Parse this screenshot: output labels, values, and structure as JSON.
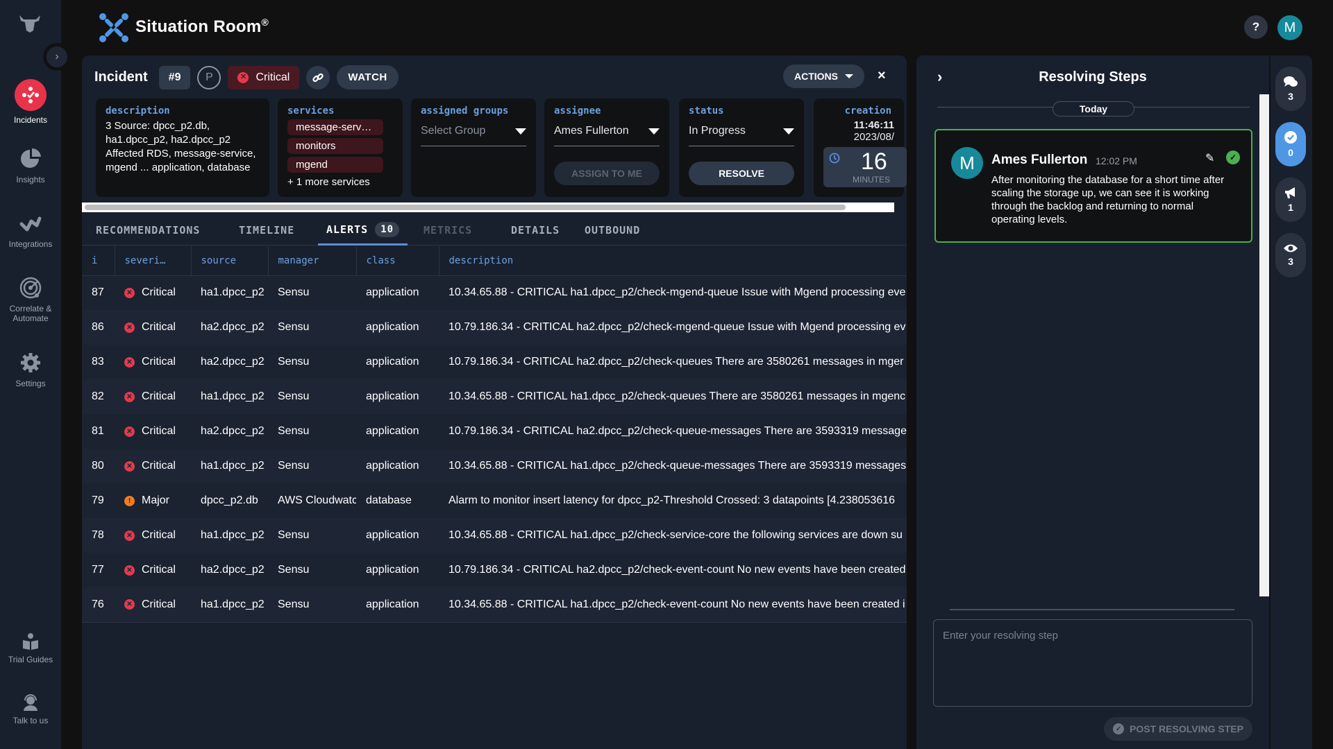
{
  "app": {
    "title": "Situation Room",
    "registered_mark": "®",
    "help_label": "?",
    "user_initial": "M"
  },
  "sidebar": {
    "expand_icon": "chevron-right-icon",
    "items": [
      {
        "label": "Incidents",
        "icon": "incidents-icon",
        "active": true
      },
      {
        "label": "Insights",
        "icon": "pie-chart-icon",
        "active": false
      },
      {
        "label": "Integrations",
        "icon": "integrations-icon",
        "active": false
      },
      {
        "label": "Correlate & Automate",
        "icon": "radar-icon",
        "active": false
      },
      {
        "label": "Settings",
        "icon": "gear-icon",
        "active": false
      }
    ],
    "bottom_items": [
      {
        "label": "Trial Guides",
        "icon": "book-reader-icon"
      },
      {
        "label": "Talk to us",
        "icon": "headset-icon"
      }
    ]
  },
  "incident": {
    "title": "Incident",
    "number": "#9",
    "priority": "P",
    "severity": "Critical",
    "watch_label": "WATCH",
    "actions_label": "ACTIONS",
    "close_label": "×",
    "description_label": "description",
    "description": "3 Source: dpcc_p2.db, ha1.dpcc_p2, ha2.dpcc_p2 Affected RDS, message-service, mgend ... application, database",
    "services_label": "services",
    "services": [
      "message-serv…",
      "monitors",
      "mgend"
    ],
    "services_more": "+ 1 more services",
    "assigned_groups_label": "assigned groups",
    "assigned_groups_placeholder": "Select Group",
    "assignee_label": "assignee",
    "assignee": "Ames Fullerton",
    "assign_to_me_label": "ASSIGN TO ME",
    "status_label": "status",
    "status": "In Progress",
    "resolve_label": "RESOLVE",
    "creation_label": "creation",
    "creation_time": "11:46:11",
    "creation_date": "2023/08/",
    "elapsed_value": "16",
    "elapsed_unit": "MINUTES"
  },
  "tabs": [
    {
      "label": "RECOMMENDATIONS",
      "state": "normal"
    },
    {
      "label": "TIMELINE",
      "state": "normal"
    },
    {
      "label": "ALERTS",
      "state": "active",
      "count": "10"
    },
    {
      "label": "METRICS",
      "state": "disabled"
    },
    {
      "label": "DETAILS",
      "state": "normal"
    },
    {
      "label": "OUTBOUND",
      "state": "normal"
    }
  ],
  "alerts": {
    "columns": [
      "i",
      "severi…",
      "source",
      "manager",
      "class",
      "description"
    ],
    "rows": [
      {
        "id": "87",
        "severity": "Critical",
        "source": "ha1.dpcc_p2",
        "manager": "Sensu",
        "class": "application",
        "description": "10.34.65.88 - CRITICAL ha1.dpcc_p2/check-mgend-queue Issue with Mgend processing eve"
      },
      {
        "id": "86",
        "severity": "Critical",
        "source": "ha2.dpcc_p2",
        "manager": "Sensu",
        "class": "application",
        "description": "10.79.186.34 - CRITICAL ha2.dpcc_p2/check-mgend-queue Issue with Mgend processing ev"
      },
      {
        "id": "83",
        "severity": "Critical",
        "source": "ha2.dpcc_p2",
        "manager": "Sensu",
        "class": "application",
        "description": "10.79.186.34 - CRITICAL ha2.dpcc_p2/check-queues There are 3580261 messages in mger"
      },
      {
        "id": "82",
        "severity": "Critical",
        "source": "ha1.dpcc_p2",
        "manager": "Sensu",
        "class": "application",
        "description": "10.34.65.88 - CRITICAL ha1.dpcc_p2/check-queues There are 3580261 messages in mgenc"
      },
      {
        "id": "81",
        "severity": "Critical",
        "source": "ha2.dpcc_p2",
        "manager": "Sensu",
        "class": "application",
        "description": "10.79.186.34 - CRITICAL ha2.dpcc_p2/check-queue-messages There are 3593319 message"
      },
      {
        "id": "80",
        "severity": "Critical",
        "source": "ha1.dpcc_p2",
        "manager": "Sensu",
        "class": "application",
        "description": "10.34.65.88 - CRITICAL ha1.dpcc_p2/check-queue-messages There are 3593319 messages"
      },
      {
        "id": "79",
        "severity": "Major",
        "source": "dpcc_p2.db",
        "manager": "AWS Cloudwatc",
        "class": "database",
        "description": "Alarm to monitor insert latency for dpcc_p2-Threshold Crossed: 3 datapoints [4.238053616"
      },
      {
        "id": "78",
        "severity": "Critical",
        "source": "ha1.dpcc_p2",
        "manager": "Sensu",
        "class": "application",
        "description": "10.34.65.88 - CRITICAL ha1.dpcc_p2/check-service-core the following services are down su"
      },
      {
        "id": "77",
        "severity": "Critical",
        "source": "ha2.dpcc_p2",
        "manager": "Sensu",
        "class": "application",
        "description": "10.79.186.34 - CRITICAL ha2.dpcc_p2/check-event-count No new events have been created"
      },
      {
        "id": "76",
        "severity": "Critical",
        "source": "ha1.dpcc_p2",
        "manager": "Sensu",
        "class": "application",
        "description": "10.34.65.88 - CRITICAL ha1.dpcc_p2/check-event-count No new events have been created i"
      }
    ]
  },
  "resolving_steps": {
    "title": "Resolving Steps",
    "date_divider": "Today",
    "steps": [
      {
        "author_initial": "M",
        "author": "Ames Fullerton",
        "time": "12:02 PM",
        "text": "After monitoring the database for a short time after scaling the storage up, we can see it is working through the backlog and returning to normal operating levels."
      }
    ],
    "input_placeholder": "Enter your resolving step",
    "post_label": "POST RESOLVING STEP"
  },
  "right_rail": [
    {
      "icon": "comments-icon",
      "count": "3",
      "active": false
    },
    {
      "icon": "verified-badge-icon",
      "count": "0",
      "active": true
    },
    {
      "icon": "megaphone-icon",
      "count": "1",
      "active": false
    },
    {
      "icon": "eye-icon",
      "count": "3",
      "active": false
    }
  ],
  "colors": {
    "critical": "#e23a4e",
    "major": "#f07c1e",
    "accent": "#4f97e5",
    "resolved_green": "#4caf50"
  }
}
